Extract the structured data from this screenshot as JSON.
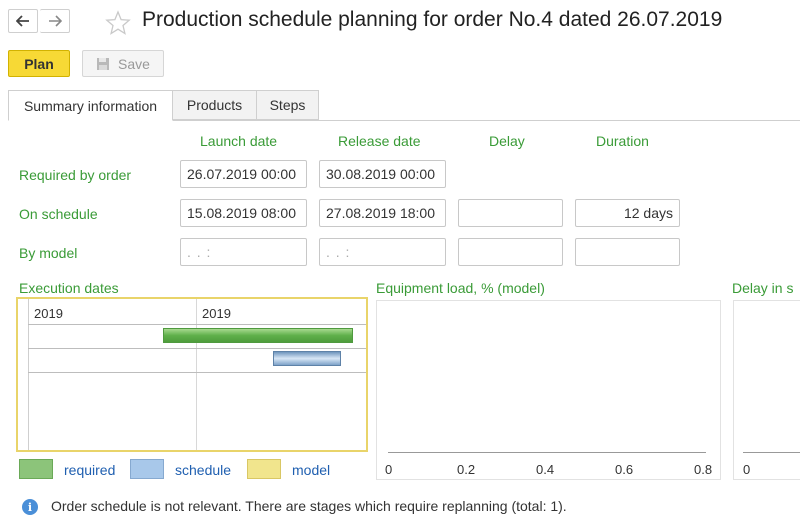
{
  "header": {
    "title": "Production schedule planning for order No.4 dated 26.07.2019",
    "back_icon": "arrow-left-icon",
    "forward_icon": "arrow-right-icon",
    "favorite_icon": "star-outline-icon"
  },
  "toolbar": {
    "plan_label": "Plan",
    "save_label": "Save",
    "save_icon": "floppy-disk-icon"
  },
  "tabs": [
    {
      "label": "Summary information",
      "active": true
    },
    {
      "label": "Products",
      "active": false
    },
    {
      "label": "Steps",
      "active": false
    }
  ],
  "summary": {
    "columns": {
      "launch_date": "Launch date",
      "release_date": "Release date",
      "delay": "Delay",
      "duration": "Duration"
    },
    "rows": {
      "required_by_order": {
        "label": "Required by order",
        "launch_date": "26.07.2019 00:00",
        "release_date": "30.08.2019 00:00"
      },
      "on_schedule": {
        "label": "On schedule",
        "launch_date": "15.08.2019 08:00",
        "release_date": "27.08.2019 18:00",
        "delay": "",
        "duration": "12 days"
      },
      "by_model": {
        "label": "By model",
        "launch_date": ". .     :",
        "release_date": ". .     :",
        "delay": "",
        "duration": ""
      }
    }
  },
  "execution_dates": {
    "title": "Execution dates",
    "period_left": "2019",
    "period_right": "2019",
    "bars": [
      {
        "series": "required"
      },
      {
        "series": "schedule"
      }
    ]
  },
  "legend": [
    {
      "label": "required",
      "color": "#8cc47a"
    },
    {
      "label": "schedule",
      "color": "#a8c8ea"
    },
    {
      "label": "model",
      "color": "#f1e58d"
    }
  ],
  "equipment_load": {
    "title": "Equipment load, % (model)",
    "ticks": [
      "0",
      "0.2",
      "0.4",
      "0.6",
      "0.8"
    ]
  },
  "delay_panel": {
    "title": "Delay in s",
    "ticks": [
      "0"
    ]
  },
  "info": {
    "message": "Order schedule is not relevant. There are stages which require replanning (total: 1).",
    "icon": "info-icon"
  },
  "colors": {
    "accent_green": "#3a9b37",
    "plan_yellow": "#f7d935",
    "link_blue": "#1f5fb0"
  }
}
